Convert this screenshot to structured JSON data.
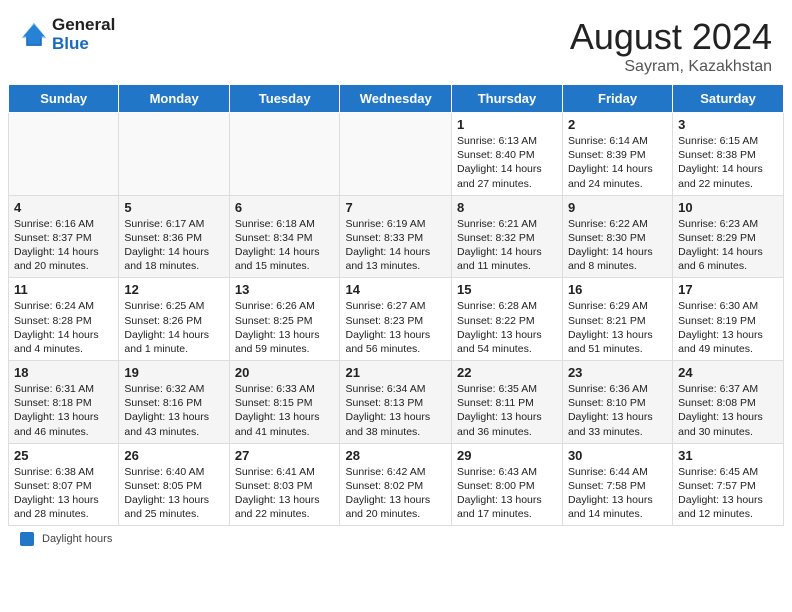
{
  "header": {
    "logo_general": "General",
    "logo_blue": "Blue",
    "month_year": "August 2024",
    "location": "Sayram, Kazakhstan"
  },
  "footer": {
    "label": "Daylight hours"
  },
  "days_of_week": [
    "Sunday",
    "Monday",
    "Tuesday",
    "Wednesday",
    "Thursday",
    "Friday",
    "Saturday"
  ],
  "weeks": [
    [
      {
        "day": "",
        "info": ""
      },
      {
        "day": "",
        "info": ""
      },
      {
        "day": "",
        "info": ""
      },
      {
        "day": "",
        "info": ""
      },
      {
        "day": "1",
        "info": "Sunrise: 6:13 AM\nSunset: 8:40 PM\nDaylight: 14 hours and 27 minutes."
      },
      {
        "day": "2",
        "info": "Sunrise: 6:14 AM\nSunset: 8:39 PM\nDaylight: 14 hours and 24 minutes."
      },
      {
        "day": "3",
        "info": "Sunrise: 6:15 AM\nSunset: 8:38 PM\nDaylight: 14 hours and 22 minutes."
      }
    ],
    [
      {
        "day": "4",
        "info": "Sunrise: 6:16 AM\nSunset: 8:37 PM\nDaylight: 14 hours and 20 minutes."
      },
      {
        "day": "5",
        "info": "Sunrise: 6:17 AM\nSunset: 8:36 PM\nDaylight: 14 hours and 18 minutes."
      },
      {
        "day": "6",
        "info": "Sunrise: 6:18 AM\nSunset: 8:34 PM\nDaylight: 14 hours and 15 minutes."
      },
      {
        "day": "7",
        "info": "Sunrise: 6:19 AM\nSunset: 8:33 PM\nDaylight: 14 hours and 13 minutes."
      },
      {
        "day": "8",
        "info": "Sunrise: 6:21 AM\nSunset: 8:32 PM\nDaylight: 14 hours and 11 minutes."
      },
      {
        "day": "9",
        "info": "Sunrise: 6:22 AM\nSunset: 8:30 PM\nDaylight: 14 hours and 8 minutes."
      },
      {
        "day": "10",
        "info": "Sunrise: 6:23 AM\nSunset: 8:29 PM\nDaylight: 14 hours and 6 minutes."
      }
    ],
    [
      {
        "day": "11",
        "info": "Sunrise: 6:24 AM\nSunset: 8:28 PM\nDaylight: 14 hours and 4 minutes."
      },
      {
        "day": "12",
        "info": "Sunrise: 6:25 AM\nSunset: 8:26 PM\nDaylight: 14 hours and 1 minute."
      },
      {
        "day": "13",
        "info": "Sunrise: 6:26 AM\nSunset: 8:25 PM\nDaylight: 13 hours and 59 minutes."
      },
      {
        "day": "14",
        "info": "Sunrise: 6:27 AM\nSunset: 8:23 PM\nDaylight: 13 hours and 56 minutes."
      },
      {
        "day": "15",
        "info": "Sunrise: 6:28 AM\nSunset: 8:22 PM\nDaylight: 13 hours and 54 minutes."
      },
      {
        "day": "16",
        "info": "Sunrise: 6:29 AM\nSunset: 8:21 PM\nDaylight: 13 hours and 51 minutes."
      },
      {
        "day": "17",
        "info": "Sunrise: 6:30 AM\nSunset: 8:19 PM\nDaylight: 13 hours and 49 minutes."
      }
    ],
    [
      {
        "day": "18",
        "info": "Sunrise: 6:31 AM\nSunset: 8:18 PM\nDaylight: 13 hours and 46 minutes."
      },
      {
        "day": "19",
        "info": "Sunrise: 6:32 AM\nSunset: 8:16 PM\nDaylight: 13 hours and 43 minutes."
      },
      {
        "day": "20",
        "info": "Sunrise: 6:33 AM\nSunset: 8:15 PM\nDaylight: 13 hours and 41 minutes."
      },
      {
        "day": "21",
        "info": "Sunrise: 6:34 AM\nSunset: 8:13 PM\nDaylight: 13 hours and 38 minutes."
      },
      {
        "day": "22",
        "info": "Sunrise: 6:35 AM\nSunset: 8:11 PM\nDaylight: 13 hours and 36 minutes."
      },
      {
        "day": "23",
        "info": "Sunrise: 6:36 AM\nSunset: 8:10 PM\nDaylight: 13 hours and 33 minutes."
      },
      {
        "day": "24",
        "info": "Sunrise: 6:37 AM\nSunset: 8:08 PM\nDaylight: 13 hours and 30 minutes."
      }
    ],
    [
      {
        "day": "25",
        "info": "Sunrise: 6:38 AM\nSunset: 8:07 PM\nDaylight: 13 hours and 28 minutes."
      },
      {
        "day": "26",
        "info": "Sunrise: 6:40 AM\nSunset: 8:05 PM\nDaylight: 13 hours and 25 minutes."
      },
      {
        "day": "27",
        "info": "Sunrise: 6:41 AM\nSunset: 8:03 PM\nDaylight: 13 hours and 22 minutes."
      },
      {
        "day": "28",
        "info": "Sunrise: 6:42 AM\nSunset: 8:02 PM\nDaylight: 13 hours and 20 minutes."
      },
      {
        "day": "29",
        "info": "Sunrise: 6:43 AM\nSunset: 8:00 PM\nDaylight: 13 hours and 17 minutes."
      },
      {
        "day": "30",
        "info": "Sunrise: 6:44 AM\nSunset: 7:58 PM\nDaylight: 13 hours and 14 minutes."
      },
      {
        "day": "31",
        "info": "Sunrise: 6:45 AM\nSunset: 7:57 PM\nDaylight: 13 hours and 12 minutes."
      }
    ]
  ]
}
